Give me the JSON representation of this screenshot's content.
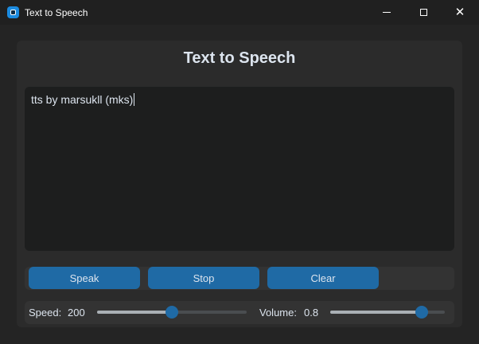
{
  "window": {
    "title": "Text to Speech"
  },
  "app": {
    "heading": "Text to Speech",
    "text_content": "tts by marsukll (mks)"
  },
  "buttons": {
    "speak": "Speak",
    "stop": "Stop",
    "clear": "Clear"
  },
  "speed": {
    "label": "Speed:",
    "value": "200",
    "slider_fraction": 0.5
  },
  "volume": {
    "label": "Volume:",
    "value": "0.8",
    "slider_fraction": 0.8
  },
  "colors": {
    "accent": "#1f6aa5",
    "background": "#242424",
    "panel": "#2b2b2b",
    "text_area": "#1d1e1e"
  }
}
